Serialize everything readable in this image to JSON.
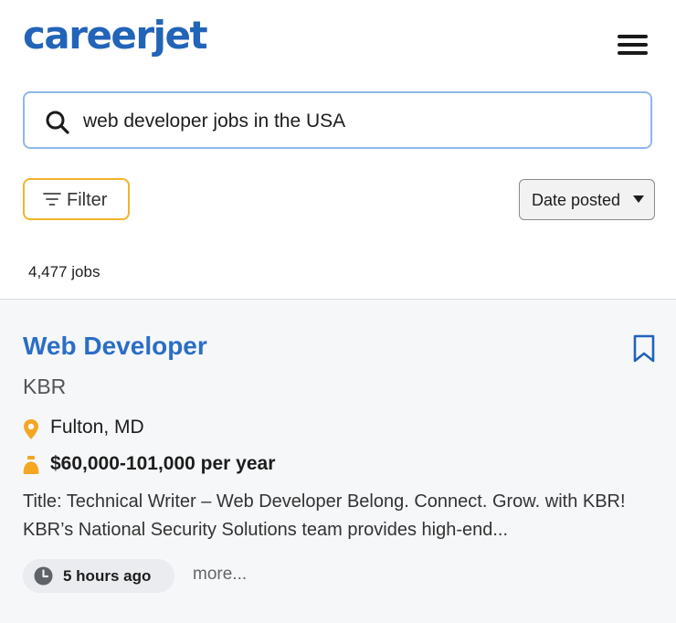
{
  "header": {
    "logo_text": "careerjet"
  },
  "search": {
    "query": "web developer jobs in the USA"
  },
  "filters": {
    "filter_label": "Filter",
    "sort_label": "Date posted"
  },
  "results": {
    "count_text": "4,477 jobs"
  },
  "job": {
    "title": "Web Developer",
    "company": "KBR",
    "location": "Fulton, MD",
    "salary": "$60,000-101,000 per year",
    "snippet": "Title: Technical Writer – Web Developer Belong. Connect. Grow. with KBR! KBR’s National Security Solutions team provides high-end...",
    "posted": "5 hours ago",
    "more_label": "more..."
  },
  "colors": {
    "brand_blue": "#2264b8",
    "link_blue": "#2a6ec6",
    "accent_orange": "#f5a623"
  },
  "icons": [
    "menu-icon",
    "search-icon",
    "filter-icon",
    "caret-down-icon",
    "bookmark-icon",
    "location-pin-icon",
    "money-bag-icon",
    "clock-icon"
  ]
}
